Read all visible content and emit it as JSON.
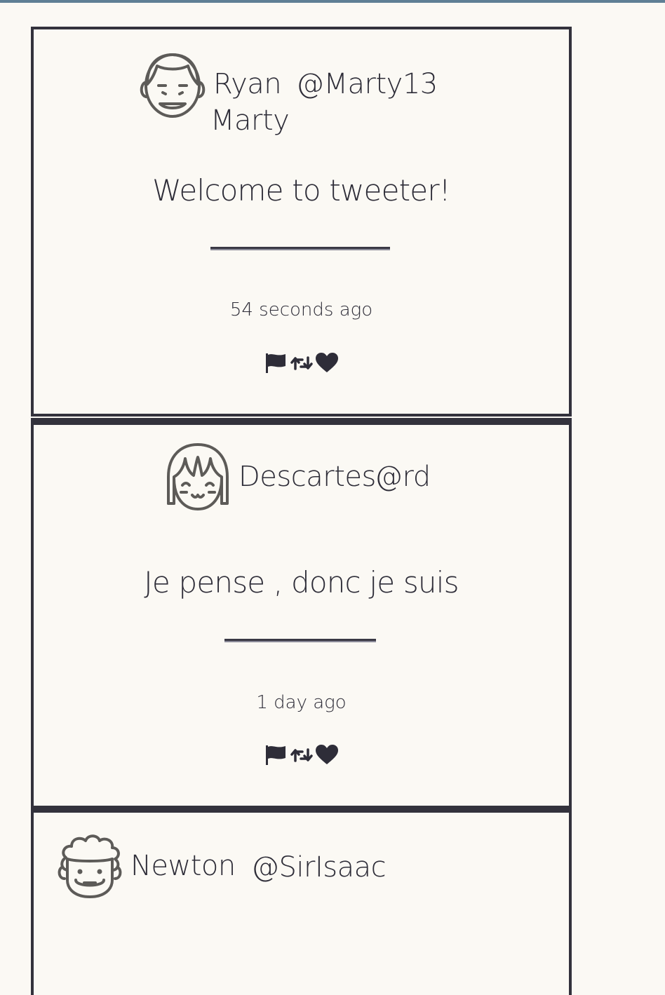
{
  "tweets": [
    {
      "first_name": "Ryan",
      "last_name": "Marty",
      "handle": "@Marty13",
      "message": "Welcome to tweeter!",
      "timestamp": "54 seconds ago",
      "avatar_icon": "smiling-man-avatar-icon"
    },
    {
      "first_name": "Descartes",
      "handle": "@rd",
      "message": "Je pense , donc je suis",
      "timestamp": "1 day ago",
      "avatar_icon": "girl-bangs-avatar-icon"
    },
    {
      "first_name": "Newton",
      "handle": "@SirIsaac",
      "avatar_icon": "curly-hair-avatar-icon"
    }
  ],
  "actions": [
    "flag-icon",
    "retweet-icon",
    "heart-icon"
  ],
  "colors": {
    "background": "#fbf9f4",
    "border": "#33323c",
    "text": "#2e2d38",
    "top_bar": "#5f7f95"
  }
}
